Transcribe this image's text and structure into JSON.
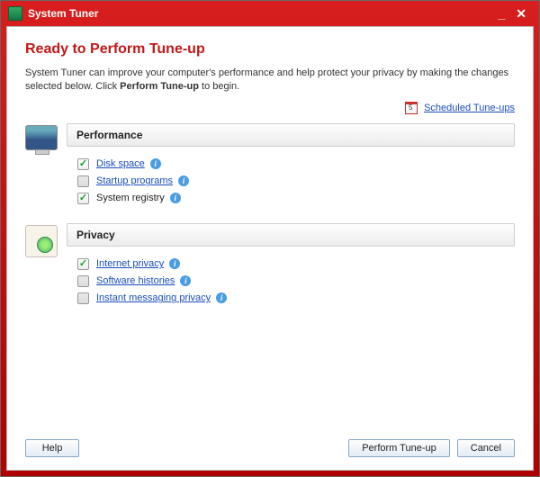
{
  "window": {
    "title": "System Tuner"
  },
  "page": {
    "heading": "Ready to Perform Tune-up",
    "desc_a": "System Tuner can improve your computer's performance and help protect your privacy by making the changes selected below. Click ",
    "desc_bold": "Perform Tune-up",
    "desc_b": " to begin.",
    "scheduled_link": "Scheduled Tune-ups"
  },
  "sections": {
    "performance": {
      "title": "Performance",
      "items": [
        {
          "label": "Disk space",
          "checked": true,
          "link": true
        },
        {
          "label": "Startup programs",
          "checked": false,
          "link": true
        },
        {
          "label": "System registry",
          "checked": true,
          "link": false
        }
      ]
    },
    "privacy": {
      "title": "Privacy",
      "items": [
        {
          "label": "Internet privacy",
          "checked": true,
          "link": true
        },
        {
          "label": "Software histories",
          "checked": false,
          "link": true
        },
        {
          "label": "Instant messaging privacy",
          "checked": false,
          "link": true
        }
      ]
    }
  },
  "buttons": {
    "help": "Help",
    "perform": "Perform Tune-up",
    "cancel": "Cancel"
  }
}
